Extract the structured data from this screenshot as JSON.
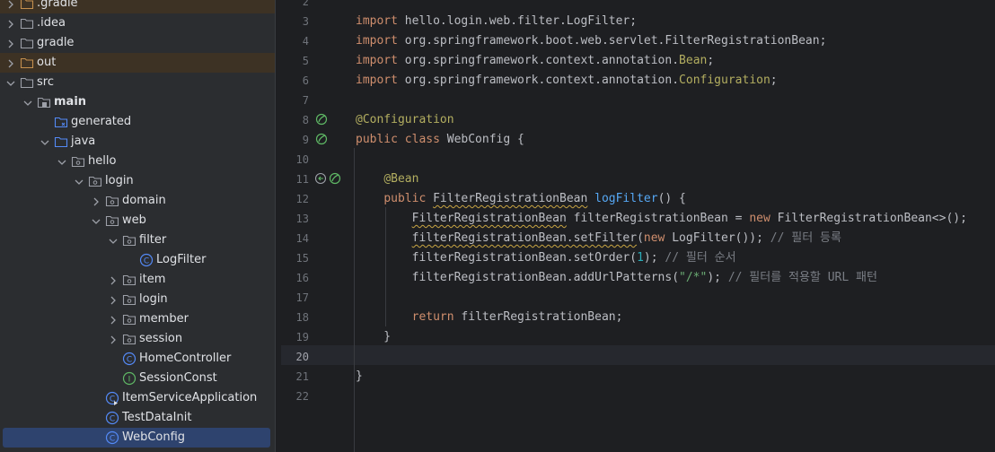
{
  "tree": {
    "items": [
      {
        "label": ".gradle",
        "depth": 0,
        "type": "folder-out",
        "expanded": false
      },
      {
        "label": ".idea",
        "depth": 0,
        "type": "folder",
        "expanded": false
      },
      {
        "label": "gradle",
        "depth": 0,
        "type": "folder",
        "expanded": false
      },
      {
        "label": "out",
        "depth": 0,
        "type": "folder-out",
        "expanded": false
      },
      {
        "label": "src",
        "depth": 0,
        "type": "folder",
        "expanded": true
      },
      {
        "label": "main",
        "depth": 1,
        "type": "folder-src",
        "expanded": true
      },
      {
        "label": "generated",
        "depth": 2,
        "type": "folder-gen",
        "expanded": null
      },
      {
        "label": "java",
        "depth": 2,
        "type": "folder-java",
        "expanded": true
      },
      {
        "label": "hello",
        "depth": 3,
        "type": "package",
        "expanded": true
      },
      {
        "label": "login",
        "depth": 4,
        "type": "package",
        "expanded": true
      },
      {
        "label": "domain",
        "depth": 5,
        "type": "package",
        "expanded": false
      },
      {
        "label": "web",
        "depth": 5,
        "type": "package",
        "expanded": true
      },
      {
        "label": "filter",
        "depth": 6,
        "type": "package",
        "expanded": true
      },
      {
        "label": "LogFilter",
        "depth": 7,
        "type": "class",
        "expanded": null
      },
      {
        "label": "item",
        "depth": 6,
        "type": "package",
        "expanded": false
      },
      {
        "label": "login",
        "depth": 6,
        "type": "package",
        "expanded": false
      },
      {
        "label": "member",
        "depth": 6,
        "type": "package",
        "expanded": false
      },
      {
        "label": "session",
        "depth": 6,
        "type": "package",
        "expanded": false
      },
      {
        "label": "HomeController",
        "depth": 6,
        "type": "class",
        "expanded": null
      },
      {
        "label": "SessionConst",
        "depth": 6,
        "type": "interface",
        "expanded": null
      },
      {
        "label": "ItemServiceApplication",
        "depth": 5,
        "type": "app-class",
        "expanded": null
      },
      {
        "label": "TestDataInit",
        "depth": 5,
        "type": "class",
        "expanded": null
      },
      {
        "label": "WebConfig",
        "depth": 5,
        "type": "class",
        "expanded": null,
        "selected": true
      }
    ]
  },
  "editor": {
    "lines": [
      {
        "n": "2",
        "tokens": []
      },
      {
        "n": "3",
        "tokens": [
          [
            "kw",
            "import"
          ],
          [
            "t",
            " hello.login.web.filter.LogFilter;"
          ]
        ]
      },
      {
        "n": "4",
        "tokens": [
          [
            "kw",
            "import"
          ],
          [
            "t",
            " org.springframework.boot.web.servlet.FilterRegistrationBean;"
          ]
        ]
      },
      {
        "n": "5",
        "tokens": [
          [
            "kw",
            "import"
          ],
          [
            "t",
            " org.springframework.context.annotation."
          ],
          [
            "cls",
            "Bean"
          ],
          [
            "t",
            ";"
          ]
        ]
      },
      {
        "n": "6",
        "tokens": [
          [
            "kw",
            "import"
          ],
          [
            "t",
            " org.springframework.context.annotation."
          ],
          [
            "cls",
            "Configuration"
          ],
          [
            "t",
            ";"
          ]
        ]
      },
      {
        "n": "7",
        "tokens": []
      },
      {
        "n": "8",
        "tokens": [
          [
            "ann",
            "@Configuration"
          ]
        ]
      },
      {
        "n": "9",
        "tokens": [
          [
            "kw",
            "public class"
          ],
          [
            "t",
            " WebConfig {"
          ]
        ]
      },
      {
        "n": "10",
        "tokens": []
      },
      {
        "n": "11",
        "tokens": [
          [
            "t",
            "    "
          ],
          [
            "ann",
            "@Bean"
          ]
        ]
      },
      {
        "n": "12",
        "tokens": [
          [
            "t",
            "    "
          ],
          [
            "kw",
            "public"
          ],
          [
            "t",
            " "
          ],
          [
            "warn",
            "FilterRegistrationBean"
          ],
          [
            "t",
            " "
          ],
          [
            "fn",
            "logFilter"
          ],
          [
            "t",
            "() {"
          ]
        ]
      },
      {
        "n": "13",
        "tokens": [
          [
            "t",
            "        "
          ],
          [
            "warn",
            "FilterRegistrationBean"
          ],
          [
            "t",
            " filterRegistrationBean = "
          ],
          [
            "kw",
            "new"
          ],
          [
            "t",
            " FilterRegistrationBean<>();"
          ]
        ]
      },
      {
        "n": "14",
        "tokens": [
          [
            "t",
            "        "
          ],
          [
            "warn",
            "filterRegistrationBean.setFilter"
          ],
          [
            "t",
            "("
          ],
          [
            "kw",
            "new"
          ],
          [
            "t",
            " LogFilter()); "
          ],
          [
            "cmt",
            "// 필터 등록"
          ]
        ]
      },
      {
        "n": "15",
        "tokens": [
          [
            "t",
            "        filterRegistrationBean.setOrder("
          ],
          [
            "num",
            "1"
          ],
          [
            "t",
            "); "
          ],
          [
            "cmt",
            "// 필터 순서"
          ]
        ]
      },
      {
        "n": "16",
        "tokens": [
          [
            "t",
            "        filterRegistrationBean.addUrlPatterns("
          ],
          [
            "str",
            "\"/*\""
          ],
          [
            "t",
            "); "
          ],
          [
            "cmt",
            "// 필터를 적용할 URL 패턴"
          ]
        ]
      },
      {
        "n": "17",
        "tokens": []
      },
      {
        "n": "18",
        "tokens": [
          [
            "t",
            "        "
          ],
          [
            "kw",
            "return"
          ],
          [
            "t",
            " filterRegistrationBean;"
          ]
        ]
      },
      {
        "n": "19",
        "tokens": [
          [
            "t",
            "    }"
          ]
        ]
      },
      {
        "n": "20",
        "tokens": [],
        "current": true
      },
      {
        "n": "21",
        "tokens": [
          [
            "t",
            "}"
          ]
        ]
      },
      {
        "n": "22",
        "tokens": []
      }
    ]
  },
  "colors": {
    "sidebar_bg": "#2b2d30",
    "editor_bg": "#1e1f22",
    "selection": "#2e436e",
    "excluded_folder": "#3d3224",
    "keyword": "#cf8e6d",
    "annotation": "#b3ae60",
    "function": "#56a8f5",
    "comment": "#7a7e85"
  }
}
